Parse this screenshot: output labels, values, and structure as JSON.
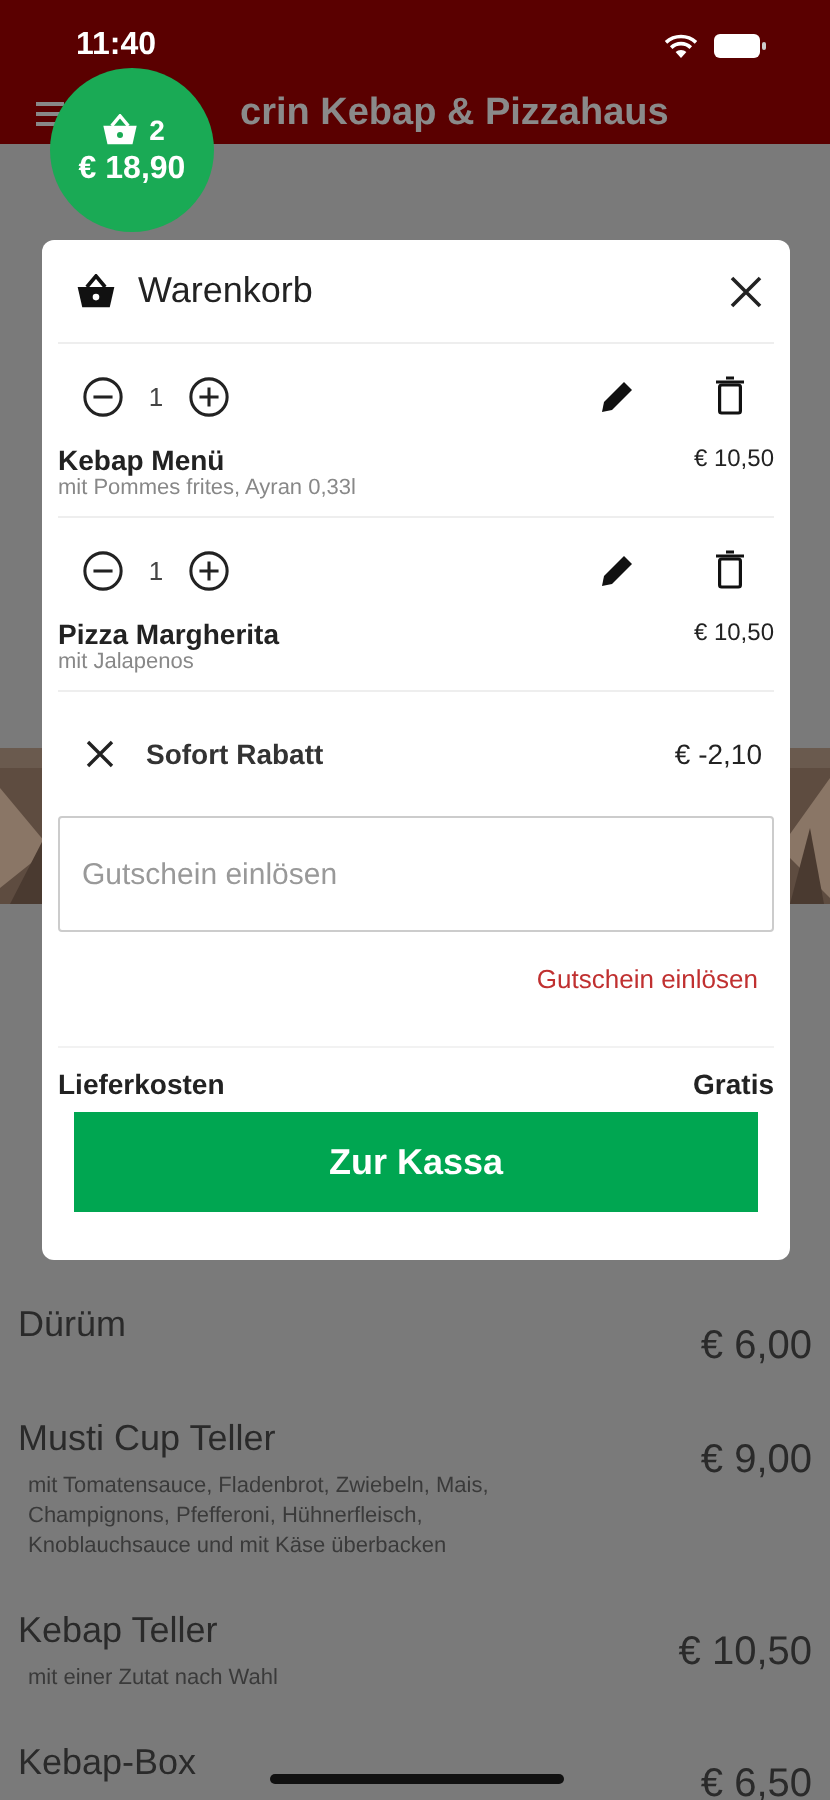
{
  "status_bar": {
    "time": "11:40"
  },
  "header": {
    "title": "crin Kebap & Pizzahaus"
  },
  "cart_badge": {
    "count": "2",
    "total": "€ 18,90"
  },
  "menu_items": [
    {
      "name": "Dürüm",
      "price": "€ 6,00"
    },
    {
      "name": "Musti Cup Teller",
      "description": "mit Tomatensauce, Fladenbrot, Zwiebeln, Mais, Champignons, Pfefferoni, Hühnerfleisch, Knoblauchsauce und mit Käse überbacken",
      "price": "€ 9,00"
    },
    {
      "name": "Kebap Teller",
      "description": "mit einer Zutat nach Wahl",
      "price": "€ 10,50"
    },
    {
      "name": "Kebap-Box",
      "price": "€ 6,50"
    }
  ],
  "cart": {
    "title": "Warenkorb",
    "items": [
      {
        "quantity": "1",
        "name": "Kebap Menü",
        "options": "mit Pommes frites, Ayran 0,33l",
        "price": "€ 10,50"
      },
      {
        "quantity": "1",
        "name": "Pizza Margherita",
        "options": "mit Jalapenos",
        "price": "€ 10,50"
      }
    ],
    "discount": {
      "label": "Sofort Rabatt",
      "amount": "€ -2,10"
    },
    "voucher": {
      "placeholder": "Gutschein einlösen",
      "link": "Gutschein einlösen"
    },
    "delivery": {
      "label": "Lieferkosten",
      "value": "Gratis"
    },
    "checkout": "Zur Kassa"
  }
}
